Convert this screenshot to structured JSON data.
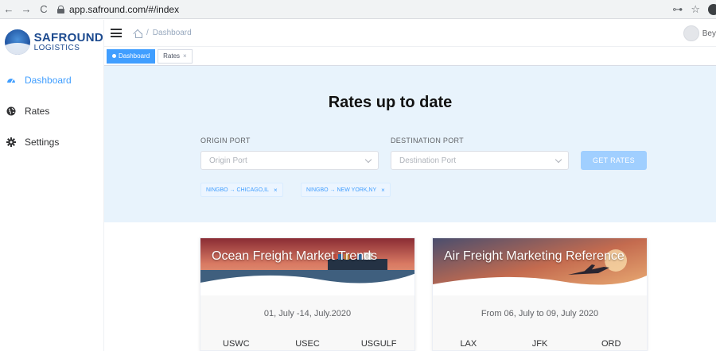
{
  "browser": {
    "back": "←",
    "forward": "→",
    "reload": "C",
    "url": "app.safround.com/#/index",
    "key_icon": "⊶",
    "star_icon": "☆"
  },
  "logo": {
    "title": "SAFROUND",
    "subtitle": "LOGISTICS"
  },
  "sidebar": {
    "items": [
      {
        "label": "Dashboard",
        "icon": "dashboard-icon",
        "active": true
      },
      {
        "label": "Rates",
        "icon": "globe-icon",
        "active": false
      },
      {
        "label": "Settings",
        "icon": "gear-icon",
        "active": false
      }
    ]
  },
  "header": {
    "breadcrumb": [
      "/",
      "Dashboard"
    ],
    "user": "Bey"
  },
  "tags": [
    {
      "label": "Dashboard",
      "active": true
    },
    {
      "label": "Rates",
      "active": false,
      "close": "×"
    }
  ],
  "hero": {
    "title": "Rates up to date",
    "origin": {
      "label": "ORIGIN PORT",
      "placeholder": "Origin Port"
    },
    "destination": {
      "label": "DESTINATION PORT",
      "placeholder": "Destination Port"
    },
    "button": "GET RATES",
    "chips": [
      {
        "text": "NINGBO → CHICAGO,IL",
        "close": "×"
      },
      {
        "text": "NINGBO → NEW YORK,NY",
        "close": "×"
      }
    ]
  },
  "cards": [
    {
      "title": "Ocean Freight Market Trends",
      "date": "01, July -14, July.2020",
      "columns": [
        "USWC",
        "USEC",
        "USGULF"
      ]
    },
    {
      "title": "Air Freight Marketing Reference",
      "date": "From 06, July to 09, July 2020",
      "columns": [
        "LAX",
        "JFK",
        "ORD"
      ]
    }
  ],
  "colors": {
    "accent": "#409eff",
    "hero_bg": "#e8f3fc",
    "button_disabled": "#a0cfff",
    "brand": "#1c4a8f"
  }
}
